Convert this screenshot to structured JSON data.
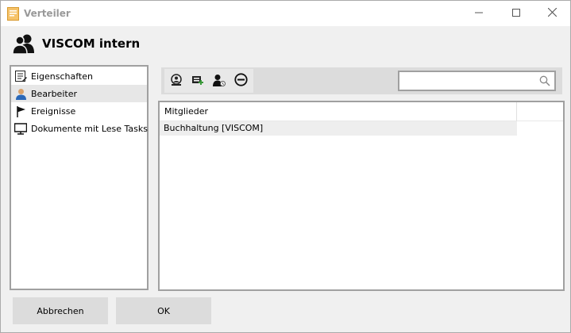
{
  "window": {
    "title": "Verteiler",
    "minimize_icon": "minimize-icon",
    "maximize_icon": "maximize-icon",
    "close_icon": "close-icon"
  },
  "header": {
    "title": "VISCOM intern",
    "icon": "users-icon"
  },
  "sidebar": {
    "items": [
      {
        "label": "Eigenschaften",
        "icon": "properties-list-icon",
        "selected": false
      },
      {
        "label": "Bearbeiter",
        "icon": "user-icon",
        "selected": true
      },
      {
        "label": "Ereignisse",
        "icon": "flag-icon",
        "selected": false
      },
      {
        "label": "Dokumente mit Lese Tasks",
        "icon": "monitor-icon",
        "selected": false
      }
    ]
  },
  "toolbar": {
    "buttons": [
      {
        "icon": "add-contact-icon"
      },
      {
        "icon": "add-group-icon"
      },
      {
        "icon": "add-user-icon"
      },
      {
        "icon": "remove-icon"
      }
    ],
    "search": {
      "value": "",
      "placeholder": "",
      "icon": "search-icon"
    }
  },
  "members": {
    "column_header": "Mitglieder",
    "rows": [
      "Buchhaltung [VISCOM]"
    ]
  },
  "footer": {
    "cancel_label": "Abbrechen",
    "ok_label": "OK"
  }
}
